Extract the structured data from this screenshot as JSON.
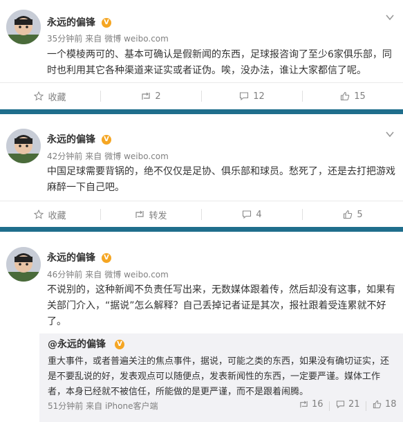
{
  "posts": [
    {
      "author": "永远的偏锋",
      "verified_badge": "V",
      "time": "35分钟前",
      "source_prefix": "来自",
      "source": "微博 weibo.com",
      "text": "一个模棱两可的、基本可确认是假新闻的东西，足球报咨询了至少6家俱乐部，同时也利用其它各种渠道来证实或者证伪。唉，没办法，谁让大家都信了呢。",
      "actions": {
        "first_label": "收藏",
        "comment": "2",
        "repost": "12",
        "like": "15"
      }
    },
    {
      "author": "永远的偏锋",
      "verified_badge": "V",
      "time": "42分钟前",
      "source_prefix": "来自",
      "source": "微博 weibo.com",
      "text": "中国足球需要背锅的，绝不仅仅是足协、俱乐部和球员。愁死了，还是去打把游戏麻醉一下自己吧。",
      "actions": {
        "first_label": "收藏",
        "second_label": "转发",
        "comment": "4",
        "like": "5"
      }
    },
    {
      "author": "永远的偏锋",
      "verified_badge": "V",
      "time": "46分钟前",
      "source_prefix": "来自",
      "source": "微博 weibo.com",
      "text": "不说别的，这种新闻不负责任写出来，无数媒体跟着传，然后却没有这事，如果有关部门介入，“据说”怎么解释？自己丢掉记者证是其次，报社跟着受连累就不好了。",
      "retweet": {
        "author": "@永远的偏锋",
        "verified_badge": "V",
        "text": "重大事件，或者普遍关注的焦点事件，据说，可能之类的东西，如果没有确切证实，还是不要乱说的好，发表观点可以随便点，发表新闻性的东西，一定要严谨。媒体工作者，本身已经就不被信任，所能做的是更严谨，而不是跟着闹腾。",
        "time": "51分钟前",
        "source_prefix": "来自",
        "source": "iPhone客户端",
        "repost": "16",
        "comment": "21",
        "like": "18"
      }
    }
  ],
  "colors": {
    "divider": "#1f6e8c",
    "badge": "#f5a623",
    "meta": "#808080"
  },
  "icons": [
    "avatar",
    "verified-icon",
    "chevron-down-icon",
    "star-icon",
    "repost-icon",
    "comment-icon",
    "like-icon"
  ]
}
